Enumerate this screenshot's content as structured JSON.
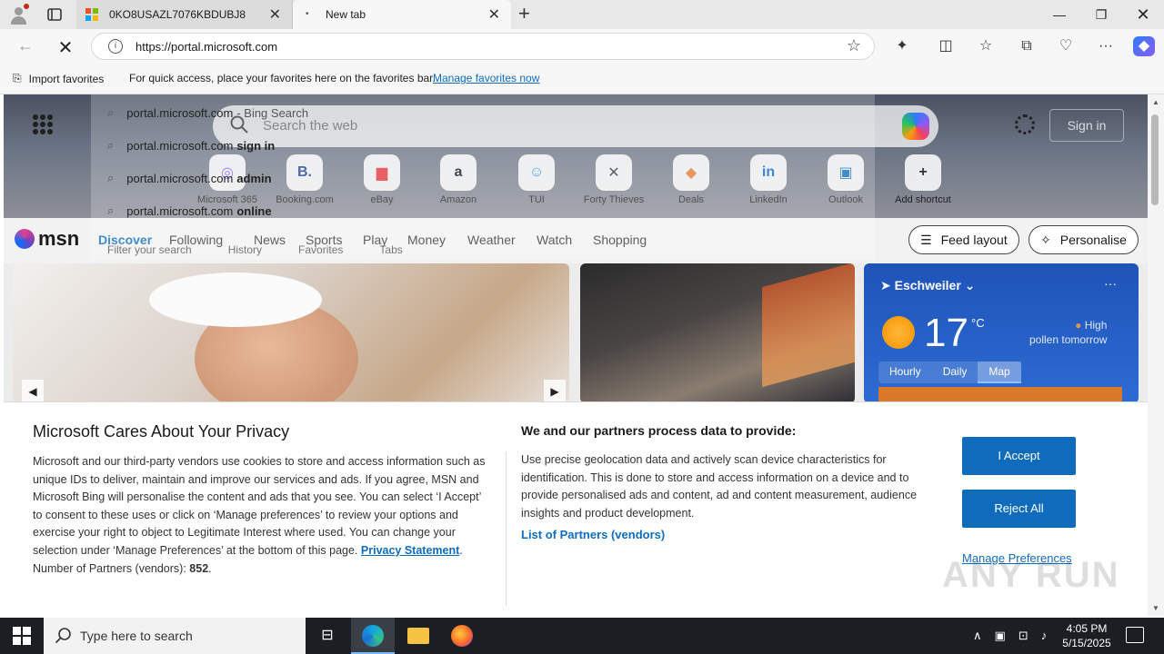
{
  "browser": {
    "tabs": [
      {
        "title": "0KO8USAZL7076KBDUBJ8",
        "active": false
      },
      {
        "title": "New tab",
        "active": true
      }
    ],
    "address": {
      "url": "https://portal.microsoft.com"
    },
    "favorites_bar": {
      "import_label": "Import favorites",
      "hint": "For quick access, place your favorites here on the favorites bar.",
      "manage_link": "Manage favorites now"
    },
    "suggestions": [
      {
        "text": "portal.microsoft.com",
        "suffix": " - Bing Search"
      },
      {
        "text": "portal.microsoft.com",
        "suffix": " sign in"
      },
      {
        "text": "portal.microsoft.com",
        "suffix": " admin"
      },
      {
        "text": "portal.microsoft.com",
        "suffix": " online"
      }
    ],
    "suggestion_filter": {
      "placeholder": "Filter your search",
      "history": "History",
      "favorites": "Favorites",
      "tabs": "Tabs"
    }
  },
  "newtab": {
    "search_placeholder": "Search the web",
    "signin": "Sign in",
    "shortcuts": [
      {
        "label": "Microsoft 365",
        "glyph": "◎",
        "color": "#7b61ff"
      },
      {
        "label": "Booking.com",
        "glyph": "B.",
        "color": "#1e3f8c"
      },
      {
        "label": "eBay",
        "glyph": "▆",
        "color": "#e53238"
      },
      {
        "label": "Amazon",
        "glyph": "a",
        "color": "#111111"
      },
      {
        "label": "TUI",
        "glyph": "☺",
        "color": "#1f8ad8"
      },
      {
        "label": "Forty Thieves",
        "glyph": "✕",
        "color": "#333333"
      },
      {
        "label": "Deals",
        "glyph": "◆",
        "color": "#e07a2f"
      },
      {
        "label": "LinkedIn",
        "glyph": "in",
        "color": "#0a66c2"
      },
      {
        "label": "Outlook",
        "glyph": "▣",
        "color": "#0f6cbd"
      },
      {
        "label": "Add shortcut",
        "glyph": "+",
        "color": "#333333"
      }
    ]
  },
  "msn": {
    "logo": "msn",
    "nav": [
      "Discover",
      "Following",
      "News",
      "Sports",
      "Play",
      "Money",
      "Weather",
      "Watch",
      "Shopping"
    ],
    "feed_layout": "Feed layout",
    "personalise": "Personalise",
    "weather": {
      "location": "Eschweiler",
      "temp": "17",
      "unit": "°C",
      "pollen_line1": "High",
      "pollen_line2": "pollen tomorrow",
      "tabs": [
        "Hourly",
        "Daily",
        "Map"
      ],
      "selected_tab": "Map",
      "more": "···"
    }
  },
  "privacy": {
    "title": "Microsoft Cares About Your Privacy",
    "body": "Microsoft and our third-party vendors use cookies to store and access information such as unique IDs to deliver, maintain and improve our services and ads. If you agree, MSN and Microsoft Bing will personalise the content and ads that you see. You can select ‘I Accept’ to consent to these uses or click on ‘Manage preferences’ to review your options and exercise your right to object to Legitimate Interest where used.  You can change your selection under ‘Manage Preferences’ at the bottom of this page.",
    "privacy_link": "Privacy Statement",
    "partners_label": "Number of Partners (vendors):",
    "partners_count": "852",
    "title2": "We and our partners process data to provide:",
    "body2": "Use precise geolocation data and actively scan device characteristics for identification. This is done to store and access information on a device and to provide personalised ads and content, ad and content measurement, audience insights and product development.",
    "partners_link": "List of Partners (vendors)",
    "accept": "I Accept",
    "reject": "Reject All",
    "manage": "Manage Preferences"
  },
  "watermark": "ANY RUN",
  "taskbar": {
    "search_placeholder": "Type here to search",
    "time": "4:05 PM",
    "date": "5/15/2025"
  }
}
